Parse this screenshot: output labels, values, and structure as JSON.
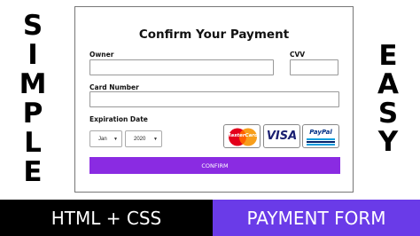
{
  "side_left_letters": [
    "S",
    "I",
    "M",
    "P",
    "L",
    "E"
  ],
  "side_right_letters": [
    "E",
    "A",
    "S",
    "Y"
  ],
  "form": {
    "title": "Confirm Your Payment",
    "owner_label": "Owner",
    "owner_value": "",
    "cvv_label": "CVV",
    "cvv_value": "",
    "card_number_label": "Card Number",
    "card_number_value": "",
    "expiration_label": "Expiration Date",
    "month_value": "Jan",
    "year_value": "2020",
    "confirm_label": "CONFIRM",
    "accent_color": "#8a2be2"
  },
  "card_logos": [
    {
      "name": "mastercard-logo",
      "text": "MasterCard"
    },
    {
      "name": "visa-logo",
      "text": "VISA"
    },
    {
      "name": "paypal-logo",
      "text": "PayPal"
    }
  ],
  "banner": {
    "left_text": "HTML + CSS",
    "right_text": "PAYMENT FORM",
    "left_color": "#000000",
    "right_color": "#6a3be8"
  }
}
